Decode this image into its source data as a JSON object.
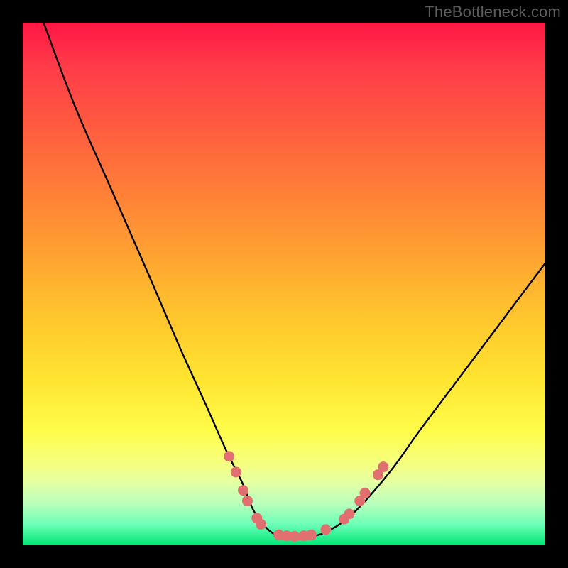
{
  "watermark": "TheBottleneck.com",
  "chart_data": {
    "type": "line",
    "title": "",
    "xlabel": "",
    "ylabel": "",
    "xlim": [
      0,
      100
    ],
    "ylim": [
      0,
      100
    ],
    "series": [
      {
        "name": "curve-left",
        "x": [
          4,
          10,
          17,
          24,
          30,
          35,
          39,
          42,
          44,
          46,
          48,
          49.5
        ],
        "y": [
          100,
          84,
          68,
          52,
          38,
          27,
          18,
          12,
          7,
          4,
          2.2,
          1.7
        ]
      },
      {
        "name": "curve-right",
        "x": [
          55.5,
          58,
          62,
          66,
          71,
          76,
          82,
          88,
          94,
          100
        ],
        "y": [
          1.7,
          2.5,
          5,
          9,
          15,
          22,
          30,
          38,
          46,
          54
        ]
      },
      {
        "name": "curve-flat",
        "x": [
          49.5,
          51,
          53,
          55.5
        ],
        "y": [
          1.7,
          1.6,
          1.6,
          1.7
        ]
      }
    ],
    "markers": {
      "name": "highlight-dots",
      "color": "#e26f6f",
      "points": [
        {
          "x": 39.5,
          "y": 17.0
        },
        {
          "x": 40.8,
          "y": 14.0
        },
        {
          "x": 42.2,
          "y": 10.5
        },
        {
          "x": 43.0,
          "y": 8.5
        },
        {
          "x": 44.8,
          "y": 5.2
        },
        {
          "x": 45.6,
          "y": 4.0
        },
        {
          "x": 49.0,
          "y": 2.0
        },
        {
          "x": 50.5,
          "y": 1.8
        },
        {
          "x": 52.0,
          "y": 1.7
        },
        {
          "x": 53.8,
          "y": 1.8
        },
        {
          "x": 55.2,
          "y": 2.0
        },
        {
          "x": 58.0,
          "y": 3.0
        },
        {
          "x": 61.5,
          "y": 5.0
        },
        {
          "x": 62.5,
          "y": 6.0
        },
        {
          "x": 64.5,
          "y": 8.5
        },
        {
          "x": 65.5,
          "y": 10.0
        },
        {
          "x": 68.0,
          "y": 13.5
        },
        {
          "x": 69.0,
          "y": 15.0
        }
      ]
    },
    "gradient_stops": [
      {
        "pos": 0.0,
        "color": "#ff1744"
      },
      {
        "pos": 0.08,
        "color": "#ff3a49"
      },
      {
        "pos": 0.25,
        "color": "#ff6a3c"
      },
      {
        "pos": 0.38,
        "color": "#ff8f34"
      },
      {
        "pos": 0.55,
        "color": "#ffc22e"
      },
      {
        "pos": 0.68,
        "color": "#ffe42f"
      },
      {
        "pos": 0.78,
        "color": "#fffc4a"
      },
      {
        "pos": 0.84,
        "color": "#f6ff7c"
      },
      {
        "pos": 0.88,
        "color": "#e4ffa3"
      },
      {
        "pos": 0.92,
        "color": "#b9ffbc"
      },
      {
        "pos": 0.96,
        "color": "#6cffb7"
      },
      {
        "pos": 1.0,
        "color": "#00e676"
      }
    ]
  }
}
